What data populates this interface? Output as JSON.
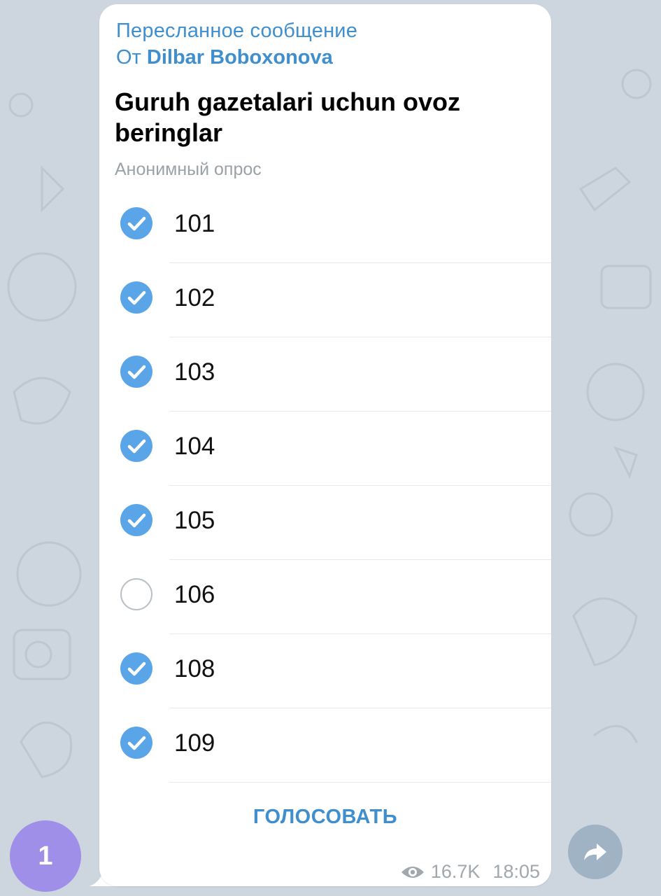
{
  "message": {
    "forward_title": "Пересланное сообщение",
    "forward_from_prefix": "От",
    "forward_from_name": "Dilbar Boboxonova",
    "question": "Guruh gazetalari uchun ovoz beringlar",
    "poll_type": "Анонимный опрос",
    "options": [
      {
        "label": "101",
        "checked": true
      },
      {
        "label": "102",
        "checked": true
      },
      {
        "label": "103",
        "checked": true
      },
      {
        "label": "104",
        "checked": true
      },
      {
        "label": "105",
        "checked": true
      },
      {
        "label": "106",
        "checked": false
      },
      {
        "label": "108",
        "checked": true
      },
      {
        "label": "109",
        "checked": true
      }
    ],
    "vote_button": "ГОЛОСОВАТЬ",
    "views": "16.7K",
    "time": "18:05"
  },
  "unread_badge": "1",
  "colors": {
    "accent": "#3f8fcf",
    "check": "#5aa5e8",
    "badge": "#9f8fe8",
    "background": "#cdd6df"
  },
  "icons": {
    "checkmark": "check-icon",
    "views": "eye-icon",
    "share": "share-icon"
  }
}
